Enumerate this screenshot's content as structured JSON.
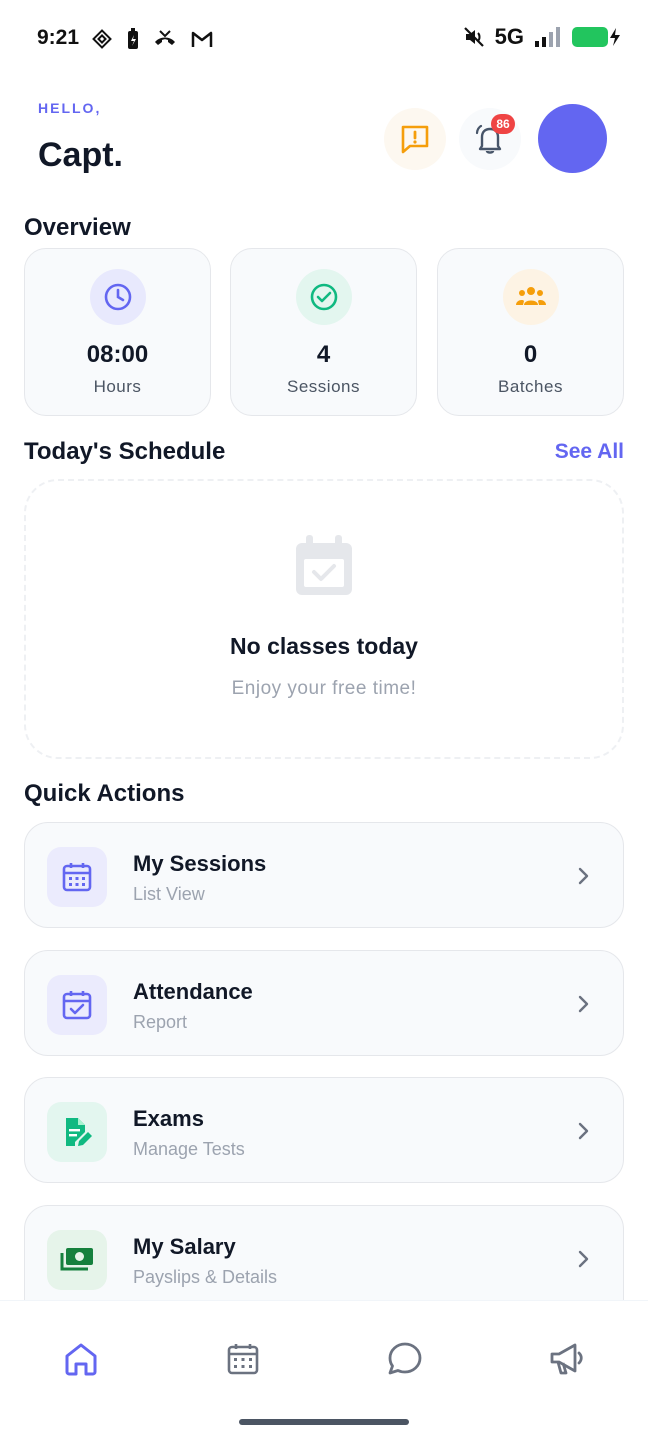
{
  "status_bar": {
    "time": "9:21",
    "network": "5G"
  },
  "header": {
    "greeting": "HELLO,",
    "name": "Capt.",
    "notification_count": "86"
  },
  "overview": {
    "title": "Overview",
    "stats": [
      {
        "value": "08:00",
        "label": "Hours",
        "icon": "clock-icon",
        "color": "#6366f1"
      },
      {
        "value": "4",
        "label": "Sessions",
        "icon": "check-circle-icon",
        "color": "#10b981"
      },
      {
        "value": "0",
        "label": "Batches",
        "icon": "group-icon",
        "color": "#f59e0b"
      }
    ]
  },
  "schedule": {
    "title": "Today's Schedule",
    "see_all": "See All",
    "empty_title": "No classes today",
    "empty_subtitle": "Enjoy your free time!"
  },
  "quick_actions": {
    "title": "Quick Actions",
    "items": [
      {
        "title": "My Sessions",
        "subtitle": "List View",
        "icon": "calendar-grid-icon",
        "color": "#6366f1"
      },
      {
        "title": "Attendance",
        "subtitle": "Report",
        "icon": "calendar-check-icon",
        "color": "#6366f1"
      },
      {
        "title": "Exams",
        "subtitle": "Manage Tests",
        "icon": "document-edit-icon",
        "color": "#10b981"
      },
      {
        "title": "My Salary",
        "subtitle": "Payslips & Details",
        "icon": "money-icon",
        "color": "#15803d"
      }
    ]
  },
  "bottom_nav": {
    "active": "home",
    "items": [
      "home-icon",
      "calendar-icon",
      "chat-icon",
      "megaphone-icon"
    ]
  },
  "colors": {
    "accent": "#6366f1",
    "success": "#10b981",
    "warning": "#f59e0b",
    "danger": "#ef4444"
  }
}
